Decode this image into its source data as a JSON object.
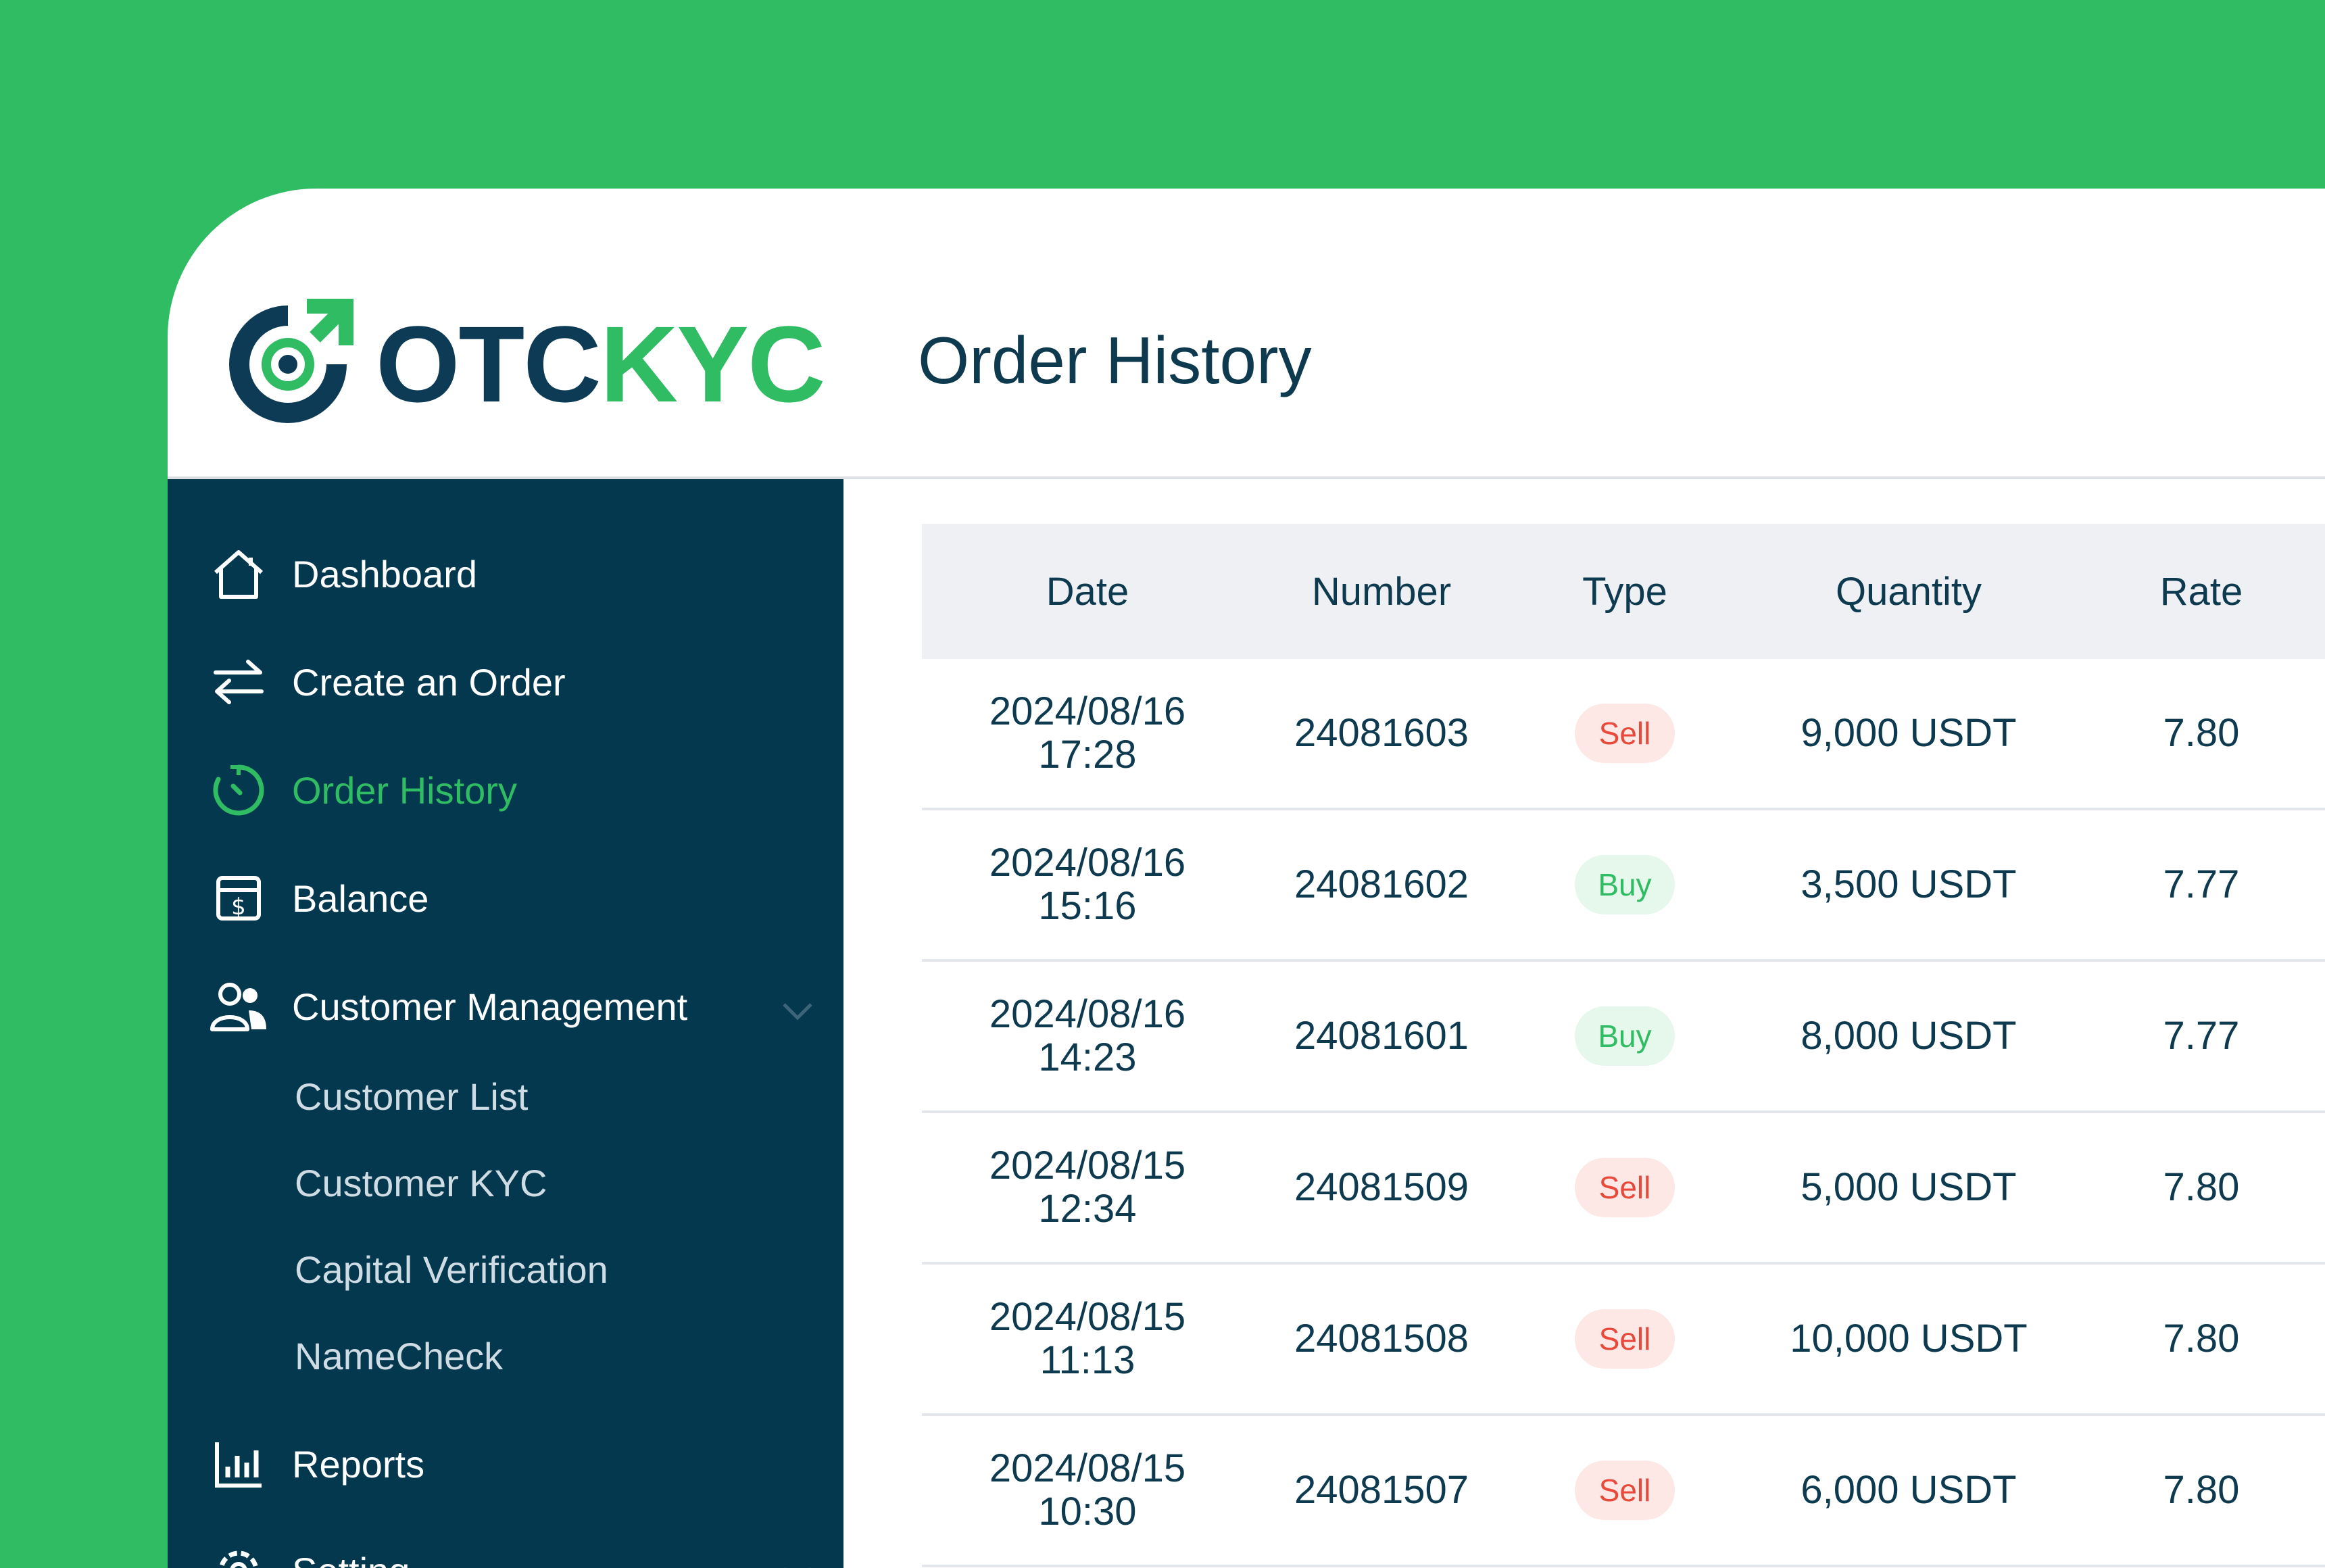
{
  "brand": {
    "part1": "OTC",
    "part2": "KYC",
    "color_dark": "#0d3b56",
    "color_green": "#2fbc62"
  },
  "header": {
    "title": "Order History"
  },
  "sidebar": {
    "items": [
      {
        "label": "Dashboard",
        "icon": "home-icon"
      },
      {
        "label": "Create an Order",
        "icon": "swap-icon"
      },
      {
        "label": "Order History",
        "icon": "clock-history-icon",
        "active": true
      },
      {
        "label": "Balance",
        "icon": "wallet-icon"
      },
      {
        "label": "Customer Management",
        "icon": "users-icon",
        "expanded": true
      },
      {
        "label": "Reports",
        "icon": "bar-chart-icon"
      },
      {
        "label": "Setting",
        "icon": "gear-icon"
      }
    ],
    "customer_sub": [
      "Customer List",
      "Customer KYC",
      "Capital Verification",
      "NameCheck"
    ]
  },
  "table": {
    "headers": {
      "date": "Date",
      "number": "Number",
      "type": "Type",
      "quantity": "Quantity",
      "rate": "Rate"
    },
    "rows": [
      {
        "date": "2024/08/16",
        "time": "17:28",
        "number": "24081603",
        "type": "Sell",
        "quantity": "9,000 USDT",
        "rate": "7.80"
      },
      {
        "date": "2024/08/16",
        "time": "15:16",
        "number": "24081602",
        "type": "Buy",
        "quantity": "3,500 USDT",
        "rate": "7.77"
      },
      {
        "date": "2024/08/16",
        "time": "14:23",
        "number": "24081601",
        "type": "Buy",
        "quantity": "8,000 USDT",
        "rate": "7.77"
      },
      {
        "date": "2024/08/15",
        "time": "12:34",
        "number": "24081509",
        "type": "Sell",
        "quantity": "5,000 USDT",
        "rate": "7.80"
      },
      {
        "date": "2024/08/15",
        "time": "11:13",
        "number": "24081508",
        "type": "Sell",
        "quantity": "10,000 USDT",
        "rate": "7.80"
      },
      {
        "date": "2024/08/15",
        "time": "10:30",
        "number": "24081507",
        "type": "Sell",
        "quantity": "6,000 USDT",
        "rate": "7.80"
      }
    ]
  }
}
